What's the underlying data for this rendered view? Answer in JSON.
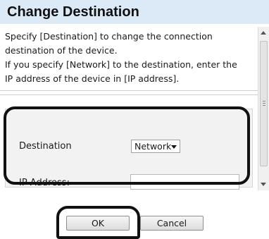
{
  "dialog": {
    "title": "Change Destination",
    "description": [
      "Specify [Destination] to change the connection",
      "destination of the device.",
      "If you specify [Network] to the destination, enter the",
      "IP address of the device in [IP address]."
    ]
  },
  "form": {
    "destination_label": "Destination",
    "destination_value": "Network",
    "ip_label": "IP Address:",
    "ip_value": ""
  },
  "buttons": {
    "ok": "OK",
    "cancel": "Cancel"
  },
  "colors": {
    "title_bar": "#dce9f6",
    "form_background": "#f2f2f2",
    "annotation_outline": "#111111"
  },
  "icons": {
    "dropdown": "chevron-down-icon",
    "scroll_up": "scroll-up-arrow-icon",
    "scroll_down": "scroll-down-arrow-icon"
  }
}
